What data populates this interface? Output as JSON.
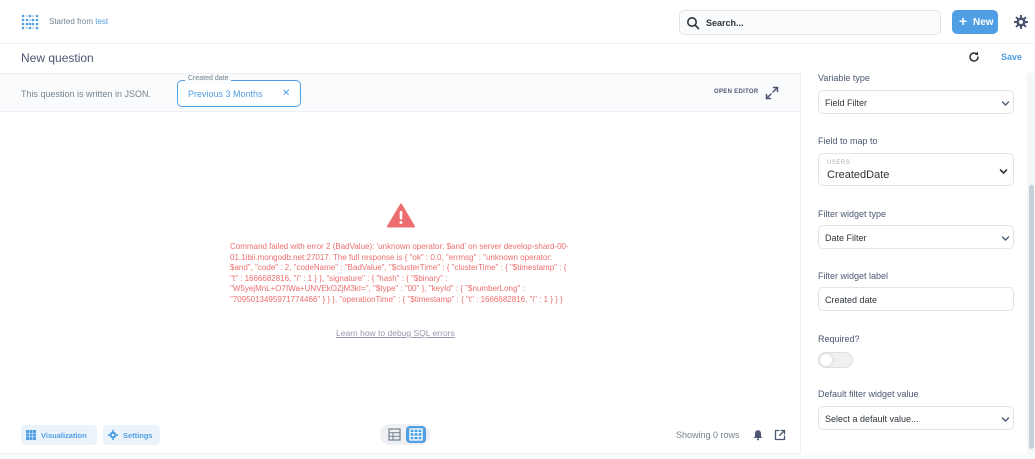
{
  "breadcrumb": {
    "prefix": "Started from",
    "link": "test"
  },
  "search": {
    "placeholder": "Search..."
  },
  "new_button": {
    "label": "New"
  },
  "question": {
    "title": "New question",
    "save_label": "Save"
  },
  "filter_bar": {
    "native_note": "This question is written in JSON.",
    "widget_legend": "Created date",
    "widget_value": "Previous 3 Months",
    "open_editor": "OPEN EDITOR"
  },
  "error": {
    "message": "Command failed with error 2 (BadValue): 'unknown operator: $and' on server develop-shard-00-01.1ibii.mongodb.net:27017. The full response is { \"ok\" : 0.0, \"errmsg\" : \"unknown operator: $and\", \"code\" : 2, \"codeName\" : \"BadValue\", \"$clusterTime\" : { \"clusterTime\" : { \"$timestamp\" : { \"t\" : 1666682816, \"i\" : 1 } }, \"signature\" : { \"hash\" : { \"$binary\" : \"W5yejMnL+O7IWa+UNVEkOZjM3kI=\", \"$type\" : \"00\" }, \"keyId\" : { \"$numberLong\" : \"7095013495971774466\" } } }, \"operationTime\" : { \"$timestamp\" : { \"t\" : 1666682816, \"i\" : 1 } } }",
    "debug_link": "Learn how to debug SQL errors"
  },
  "footer": {
    "visualization_label": "Visualization",
    "settings_label": "Settings",
    "rows_label": "Showing 0 rows"
  },
  "panel": {
    "variable_type_label": "Variable type",
    "variable_type_value": "Field Filter",
    "field_map_label": "Field to map to",
    "field_map_table": "USERS",
    "field_map_field": "CreatedDate",
    "widget_type_label": "Filter widget type",
    "widget_type_value": "Date Filter",
    "widget_label_label": "Filter widget label",
    "widget_label_value": "Created date",
    "required_label": "Required?",
    "required_value": false,
    "default_label": "Default filter widget value",
    "default_placeholder": "Select a default value..."
  },
  "colors": {
    "brand": "#509ee3",
    "error": "#ed6e6e",
    "text": "#4c5773"
  },
  "icons": [
    "metabase-logo",
    "search-icon",
    "plus-icon",
    "gear-icon",
    "refresh-icon",
    "close-icon",
    "expand-icon",
    "warning-icon",
    "visualization-icon",
    "settings-icon",
    "table-icon",
    "grid-icon",
    "bell-icon",
    "external-link-icon",
    "chevron-down-icon"
  ]
}
